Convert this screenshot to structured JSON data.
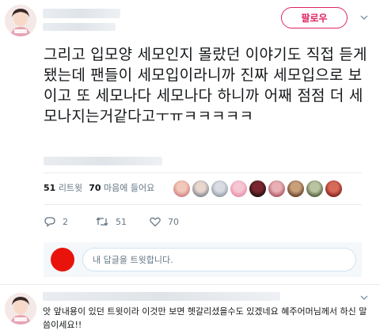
{
  "header": {
    "follow_label": "팔로우"
  },
  "tweet": {
    "text": "그리고 입모양 세모인지 몰랐던 이야기도 직접 듣게됐는데 팬들이 세모입이라니까 진짜 세모입으로 보이고 또 세모나다 세모나다 하니까 어째 점점 더 세모나지는거같다고ㅜㅠㅋㅋㅋㅋㅋ"
  },
  "stats": {
    "retweets_count": "51",
    "retweets_label": "리트윗",
    "likes_count": "70",
    "likes_label": "마음에 들어요"
  },
  "actions": {
    "reply_count": "2",
    "retweet_count": "51",
    "like_count": "70"
  },
  "reply_composer": {
    "placeholder": "내 답글을 트윗합니다."
  },
  "reply": {
    "text": "앗 앞내용이 있던 트윗이라 이것만 보면 헷갈리셨을수도 있겠네요 혜주어머님께서 하신 말씀이세요!!"
  },
  "colors": {
    "accent": "#e0245e",
    "retweet": "#657786",
    "reply_avatar": "#e8140c"
  }
}
